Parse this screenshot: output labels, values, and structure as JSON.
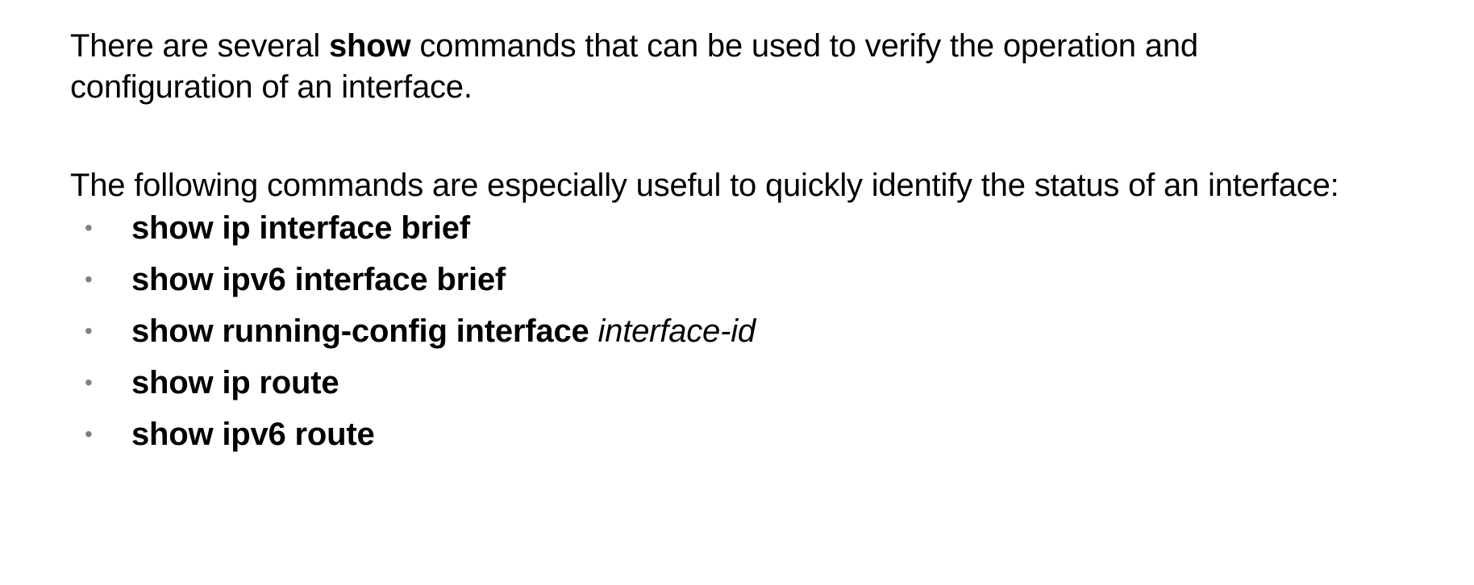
{
  "intro": {
    "text_before": "There are several ",
    "bold_word": "show",
    "text_after": " commands that can be used to verify the operation and configuration of an interface."
  },
  "second": {
    "text": "The following commands are especially useful to quickly identify the status of an interface:"
  },
  "bullet_glyph": "•",
  "commands": [
    {
      "command": "show ip interface brief",
      "param": ""
    },
    {
      "command": "show ipv6 interface brief",
      "param": ""
    },
    {
      "command": "show running-config interface",
      "param": "interface-id"
    },
    {
      "command": "show ip route",
      "param": ""
    },
    {
      "command": "show ipv6 route",
      "param": ""
    }
  ],
  "colors": {
    "text": "#000000",
    "bullet": "#808080",
    "background": "#ffffff"
  }
}
